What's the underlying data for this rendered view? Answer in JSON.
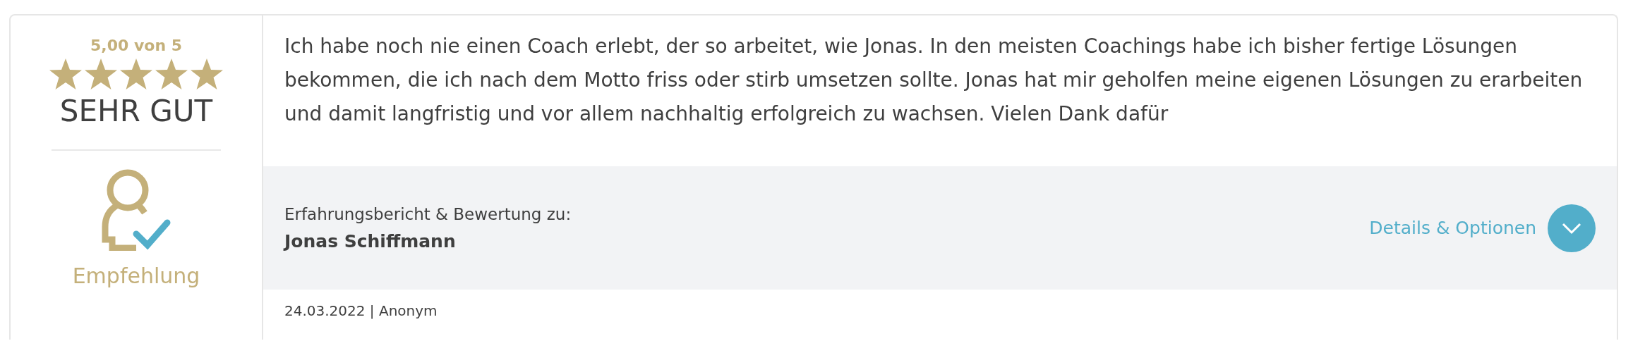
{
  "rating": {
    "score": "5,00 von 5",
    "stars": 5,
    "verdict": "SEHR GUT",
    "badge": "Empfehlung"
  },
  "review": {
    "text": "Ich habe noch nie einen Coach erlebt, der so arbeitet, wie Jonas. In den meisten Coachings habe ich bisher fertige Lösungen bekommen, die ich nach dem Motto friss oder stirb umsetzen sollte. Jonas hat mir geholfen meine eigenen Lösungen zu erarbeiten und damit langfristig und vor allem nachhaltig erfolgreich zu wachsen. Vielen Dank dafür"
  },
  "subject": {
    "label": "Erfahrungsbericht & Bewertung zu:",
    "name": "Jonas Schiffmann",
    "link": "Details & Optionen",
    "expanded": false
  },
  "meta": "24.03.2022 | Anonym"
}
